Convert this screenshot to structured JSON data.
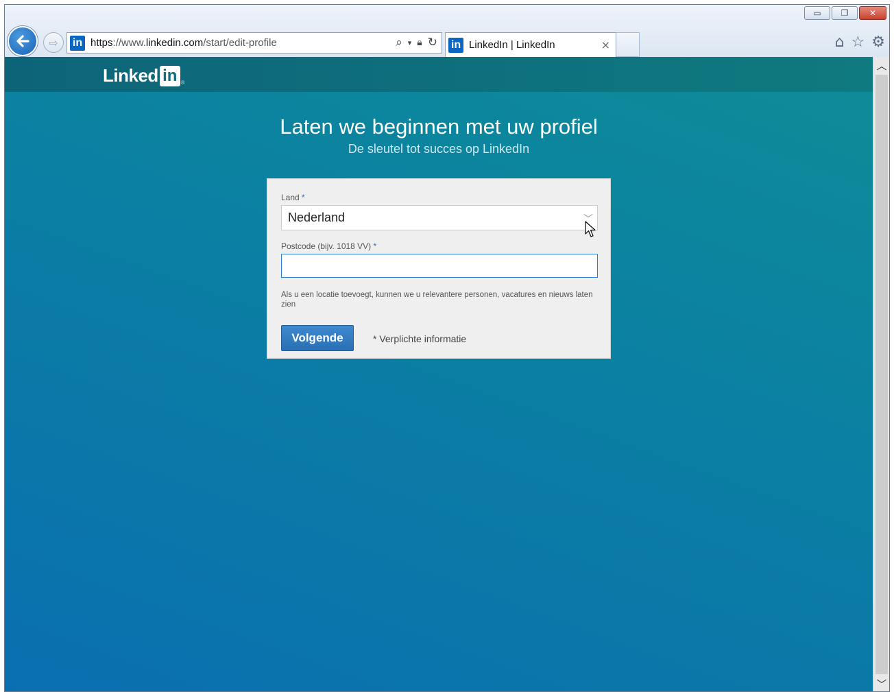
{
  "browser": {
    "address": {
      "protocol": "https",
      "separator": "://www.",
      "host": "linkedin.com",
      "path": "/start/edit-profile"
    },
    "tab_title": "LinkedIn | LinkedIn",
    "tab_close": "×",
    "back_glyph": "🡐",
    "forward_glyph": "⇨",
    "favicon_text": "in",
    "window_controls": {
      "minimize": "▭",
      "restore": "❐",
      "close": "✕"
    },
    "toolbar_icons": [
      "home-icon",
      "favorites-star-icon",
      "settings-gear-icon"
    ]
  },
  "linkedin": {
    "brand_word": "Linked",
    "brand_in": "in",
    "brand_reg": "®",
    "heading": "Laten we beginnen met uw profiel",
    "subheading": "De sleutel tot succes op LinkedIn",
    "form": {
      "country_label": "Land",
      "required_mark": "*",
      "country_value": "Nederland",
      "postcode_label": "Postcode (bijv. 1018 VV)",
      "postcode_value": "",
      "help_text": "Als u een locatie toevoegt, kunnen we u relevantere personen, vacatures en nieuws laten zien",
      "next_button": "Volgende",
      "required_note": "* Verplichte informatie"
    }
  },
  "colors": {
    "linkedin_blue": "#0b66c2",
    "button_blue": "#2a6fb3",
    "page_teal": "#0e8c98"
  }
}
